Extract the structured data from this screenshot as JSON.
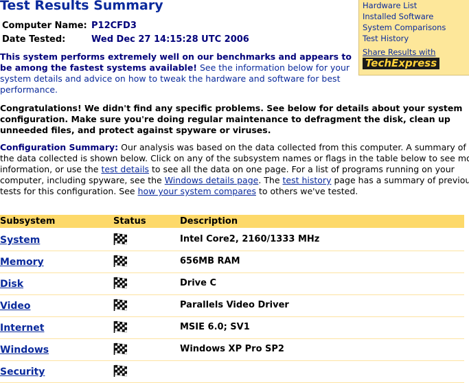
{
  "title": "Test Results Summary",
  "computer": {
    "name_label": "Computer Name:",
    "name_value": "P12CFD3",
    "date_label": "Date Tested:",
    "date_value": "Wed Dec 27 14:15:28 UTC 2006"
  },
  "panel": {
    "links": [
      "Hardware List",
      "Installed Software",
      "System Comparisons",
      "Test History"
    ],
    "share_label": "Share Results with",
    "logo_text": "TechExpress"
  },
  "intro": {
    "strong": "This system performs extremely well on our benchmarks and appears to be among the fastest systems available!",
    "rest": " See the information below for your system details and advice on how to tweak the hardware and software for best performance."
  },
  "congrats": "Congratulations! We didn't find any specific problems. See below for details about your system configuration. Make sure you're doing regular maintenance to defragment the disk, clean up unneeded files, and protect against spyware or viruses.",
  "config": {
    "heading": "Configuration Summary:",
    "t1": " Our analysis was based on the data collected from this computer. A summary of the data collected is shown below. Click on any of the subsystem names or flags in the table below to see more information, or use the ",
    "link1": "test details",
    "t2": " to see all the data on one page. For a list of programs running on your computer, including spyware, see the ",
    "link2": "Windows details page",
    "t3": ". The ",
    "link3": "test history",
    "t4": " page has a summary of previous tests for this configuration. See ",
    "link4": "how your system compares",
    "t5": " to others we've tested."
  },
  "table": {
    "headers": [
      "Subsystem",
      "Status",
      "Description"
    ],
    "rows": [
      {
        "subsystem": "System",
        "description": "Intel Core2, 2160/1333 MHz"
      },
      {
        "subsystem": "Memory",
        "description": "656MB RAM"
      },
      {
        "subsystem": "Disk",
        "description": "Drive C"
      },
      {
        "subsystem": "Video",
        "description": "Parallels Video Driver"
      },
      {
        "subsystem": "Internet",
        "description": "MSIE 6.0; SV1"
      },
      {
        "subsystem": "Windows",
        "description": "Windows XP Pro SP2"
      },
      {
        "subsystem": "Security",
        "description": ""
      }
    ]
  }
}
